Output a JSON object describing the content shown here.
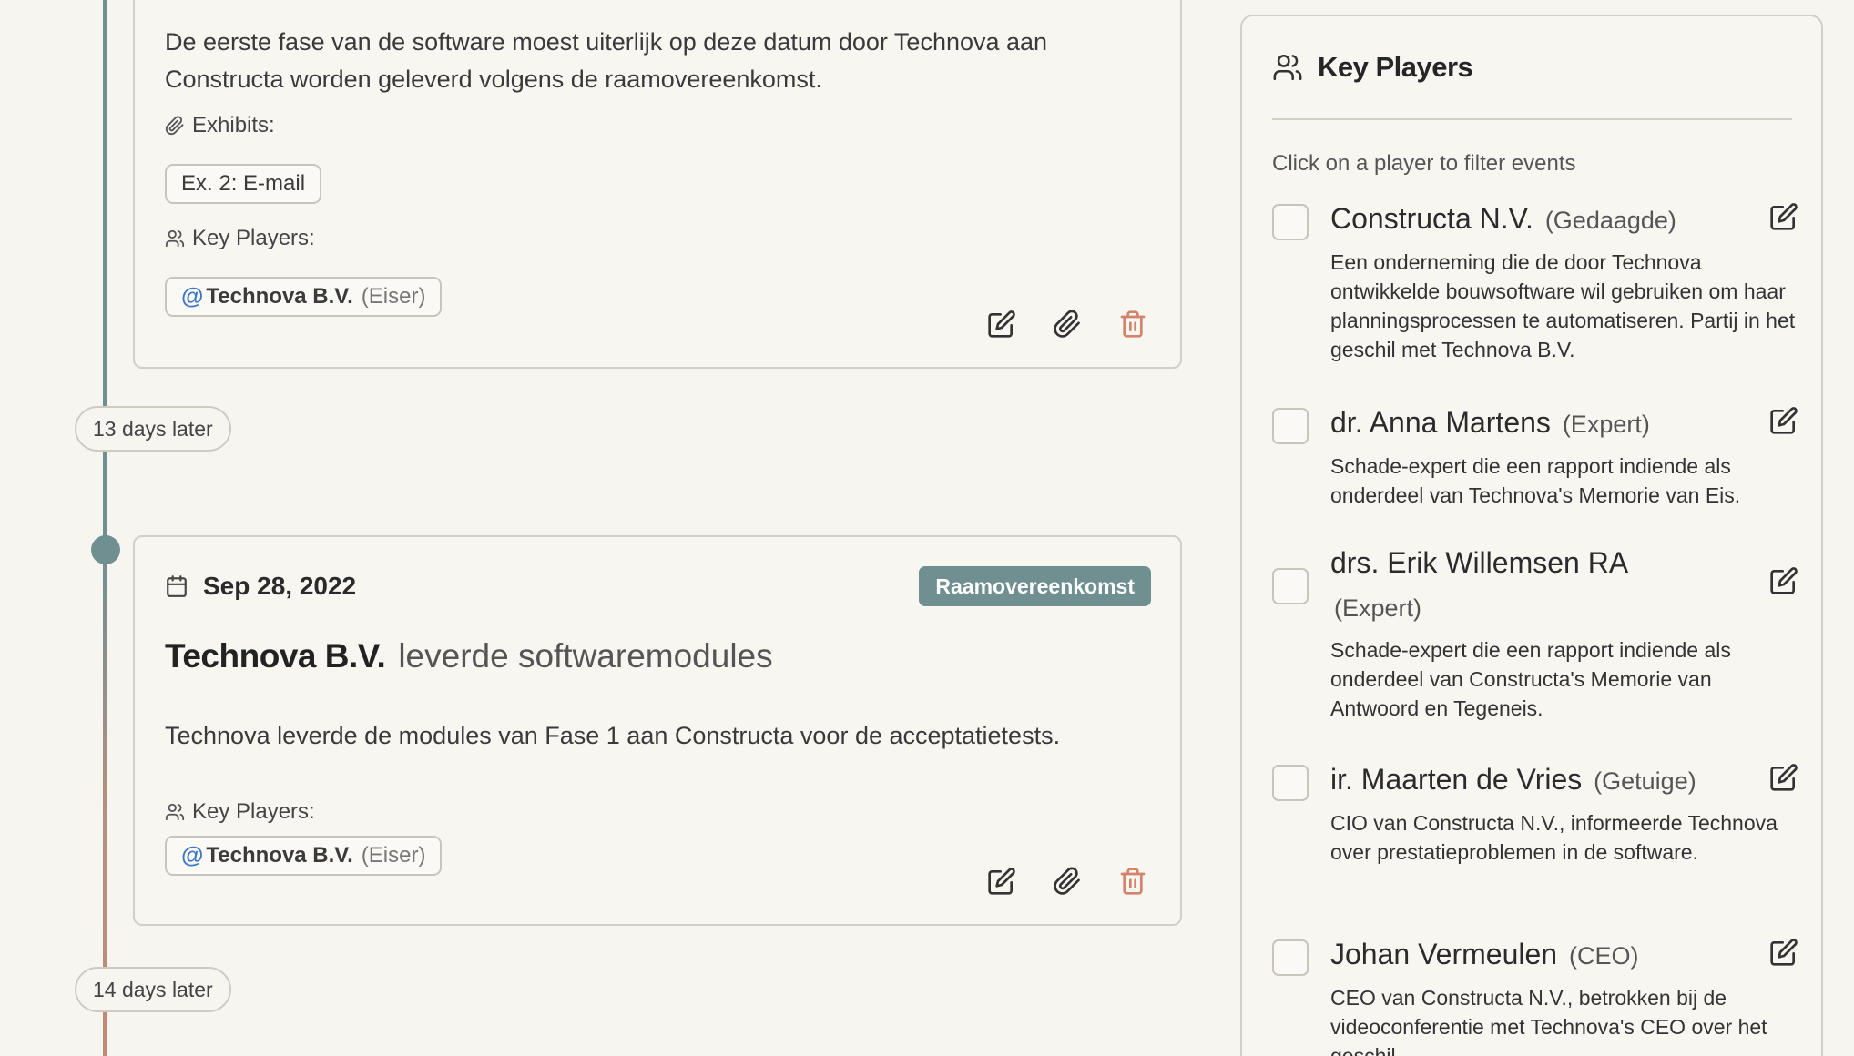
{
  "timeline": {
    "gaps": [
      "13 days later",
      "14 days later"
    ]
  },
  "event1": {
    "description": "De eerste fase van de software moest uiterlijk op deze datum door Technova aan Constructa worden geleverd volgens de raamovereenkomst.",
    "exhibits_label": "Exhibits:",
    "exhibit": "Ex. 2: E-mail",
    "key_players_label": "Key Players:",
    "player": {
      "at": "@",
      "name": "Technova B.V.",
      "role": "(Eiser)"
    }
  },
  "event2": {
    "date": "Sep 28, 2022",
    "tag": "Raamovereenkomst",
    "actor": "Technova B.V.",
    "action": "leverde softwaremodules",
    "description": "Technova leverde de modules van Fase 1 aan Constructa voor de acceptatietests.",
    "key_players_label": "Key Players:",
    "player": {
      "at": "@",
      "name": "Technova B.V.",
      "role": "(Eiser)"
    }
  },
  "panel": {
    "title": "Key Players",
    "hint": "Click on a player to filter events",
    "players": [
      {
        "name": "Constructa N.V.",
        "role": "(Gedaagde)",
        "description": "Een onderneming die de door Technova ontwikkelde bouwsoftware wil gebruiken om haar planningsprocessen te automatiseren. Partij in het geschil met Technova B.V."
      },
      {
        "name": "dr. Anna Martens",
        "role": "(Expert)",
        "description": "Schade-expert die een rapport indiende als onderdeel van Technova's Memorie van Eis."
      },
      {
        "name": "drs. Erik Willemsen RA",
        "role": "(Expert)",
        "description": "Schade-expert die een rapport indiende als onderdeel van Constructa's Memorie van Antwoord en Tegeneis."
      },
      {
        "name": "ir. Maarten de Vries",
        "role": "(Getuige)",
        "description": "CIO van Constructa N.V., informeerde Technova over prestatieproblemen in de software."
      },
      {
        "name": "Johan Vermeulen",
        "role": "(CEO)",
        "description": "CEO van Constructa N.V., betrokken bij de videoconferentie met Technova's CEO over het geschil."
      }
    ]
  },
  "colors": {
    "accent": "#6f8f91",
    "delete": "#d4826a",
    "link_at": "#3d78c2"
  }
}
